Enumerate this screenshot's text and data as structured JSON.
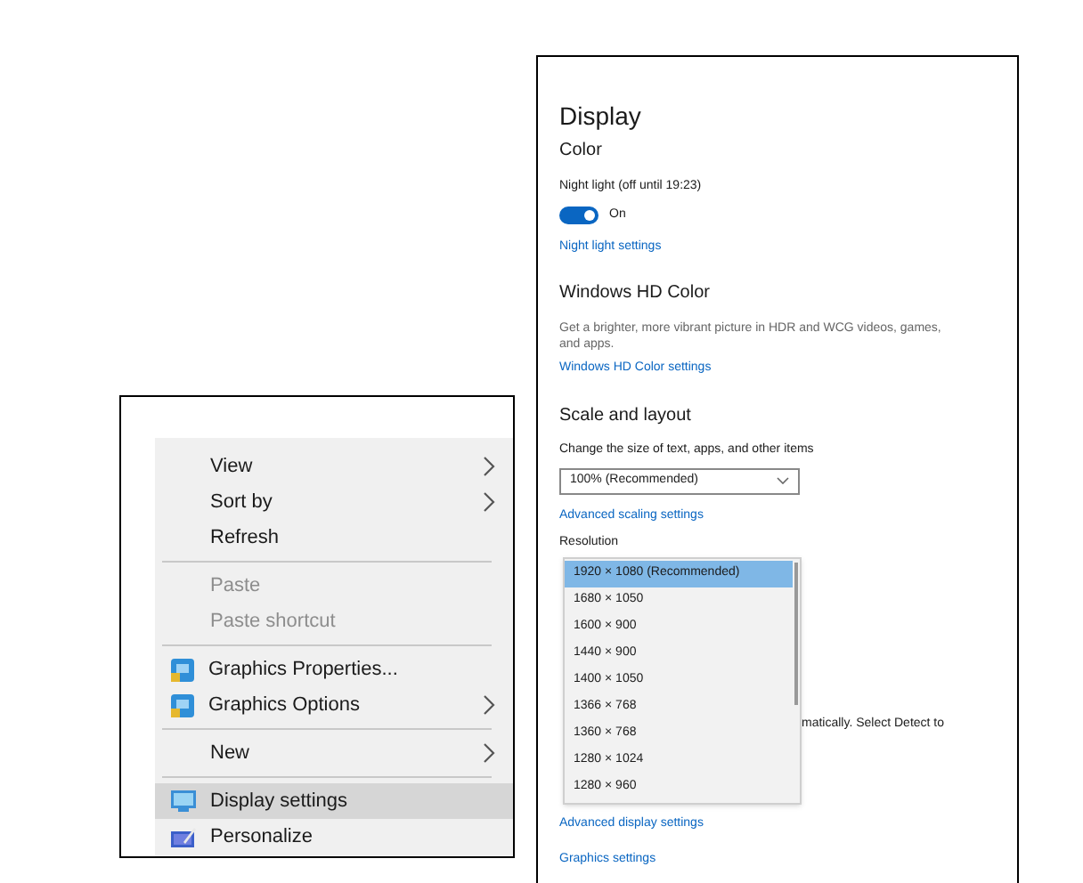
{
  "context_menu": {
    "items": [
      {
        "kind": "plain",
        "label": "View",
        "submenu": true,
        "disabled": false,
        "selected": false
      },
      {
        "kind": "plain",
        "label": "Sort by",
        "submenu": true,
        "disabled": false,
        "selected": false
      },
      {
        "kind": "plain",
        "label": "Refresh",
        "submenu": false,
        "disabled": false,
        "selected": false
      },
      {
        "kind": "separator"
      },
      {
        "kind": "plain",
        "label": "Paste",
        "submenu": false,
        "disabled": true,
        "selected": false
      },
      {
        "kind": "plain",
        "label": "Paste shortcut",
        "submenu": false,
        "disabled": true,
        "selected": false
      },
      {
        "kind": "separator"
      },
      {
        "kind": "graphics",
        "label": "Graphics Properties...",
        "submenu": false,
        "disabled": false,
        "selected": false
      },
      {
        "kind": "graphics",
        "label": "Graphics Options",
        "submenu": true,
        "disabled": false,
        "selected": false
      },
      {
        "kind": "separator"
      },
      {
        "kind": "plain",
        "label": "New",
        "submenu": true,
        "disabled": false,
        "selected": false
      },
      {
        "kind": "separator"
      },
      {
        "kind": "display",
        "label": "Display settings",
        "submenu": false,
        "disabled": false,
        "selected": true
      },
      {
        "kind": "personalize",
        "label": "Personalize",
        "submenu": false,
        "disabled": false,
        "selected": false
      }
    ]
  },
  "settings": {
    "title": "Display",
    "color": {
      "heading": "Color",
      "night_light_label": "Night light (off until 19:23)",
      "toggle": {
        "on": true,
        "label": "On"
      },
      "link": "Night light settings"
    },
    "hd_color": {
      "heading": "Windows HD Color",
      "description": "Get a brighter, more vibrant picture in HDR and WCG videos, games, and apps.",
      "link": "Windows HD Color settings"
    },
    "scale": {
      "heading": "Scale and layout",
      "size_label": "Change the size of text, apps, and other items",
      "size_value": "100% (Recommended)",
      "link": "Advanced scaling settings",
      "resolution_label": "Resolution",
      "covered_text": "matically. Select Detect to",
      "links": [
        "Advanced display settings",
        "Graphics settings"
      ]
    },
    "resolution_list": [
      {
        "label": "1920 × 1080 (Recommended)",
        "selected": true
      },
      {
        "label": "1680 × 1050",
        "selected": false
      },
      {
        "label": "1600 × 900",
        "selected": false
      },
      {
        "label": "1440 × 900",
        "selected": false
      },
      {
        "label": "1400 × 1050",
        "selected": false
      },
      {
        "label": "1366 × 768",
        "selected": false
      },
      {
        "label": "1360 × 768",
        "selected": false
      },
      {
        "label": "1280 × 1024",
        "selected": false
      },
      {
        "label": "1280 × 960",
        "selected": false
      }
    ]
  }
}
